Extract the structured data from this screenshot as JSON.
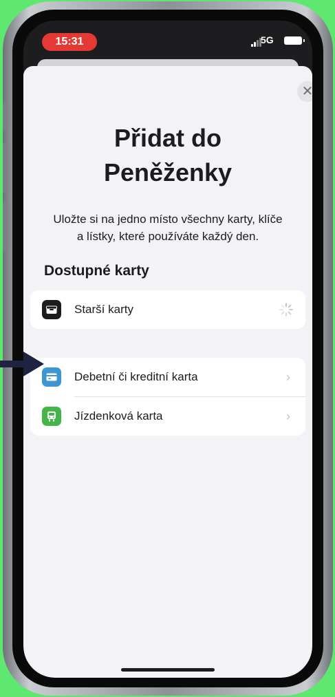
{
  "status_bar": {
    "time": "15:31",
    "network": "5G"
  },
  "sheet": {
    "close_symbol": "✕",
    "title_line1": "Přidat do",
    "title_line2": "Peněženky",
    "subtitle_line1": "Uložte si na jedno místo všechny karty, klíče",
    "subtitle_line2": "a lístky, které používáte každý den.",
    "section_title": "Dostupné karty",
    "groups": [
      {
        "items": [
          {
            "label": "Starší karty",
            "icon": "wallet-icon",
            "icon_bg": "#1c1c1e",
            "accessory": "spinner"
          }
        ]
      },
      {
        "items": [
          {
            "label": "Debetní či kreditní karta",
            "icon": "credit-card-icon",
            "icon_bg": "#3e95d4",
            "accessory": "›"
          },
          {
            "label": "Jízdenková karta",
            "icon": "tram-icon",
            "icon_bg": "#45b549",
            "accessory": "›"
          }
        ]
      }
    ]
  },
  "colors": {
    "background": "#5ee86f",
    "time_pill": "#e53935",
    "arrow": "#1f2340",
    "sheet": "#f2f2f7"
  }
}
